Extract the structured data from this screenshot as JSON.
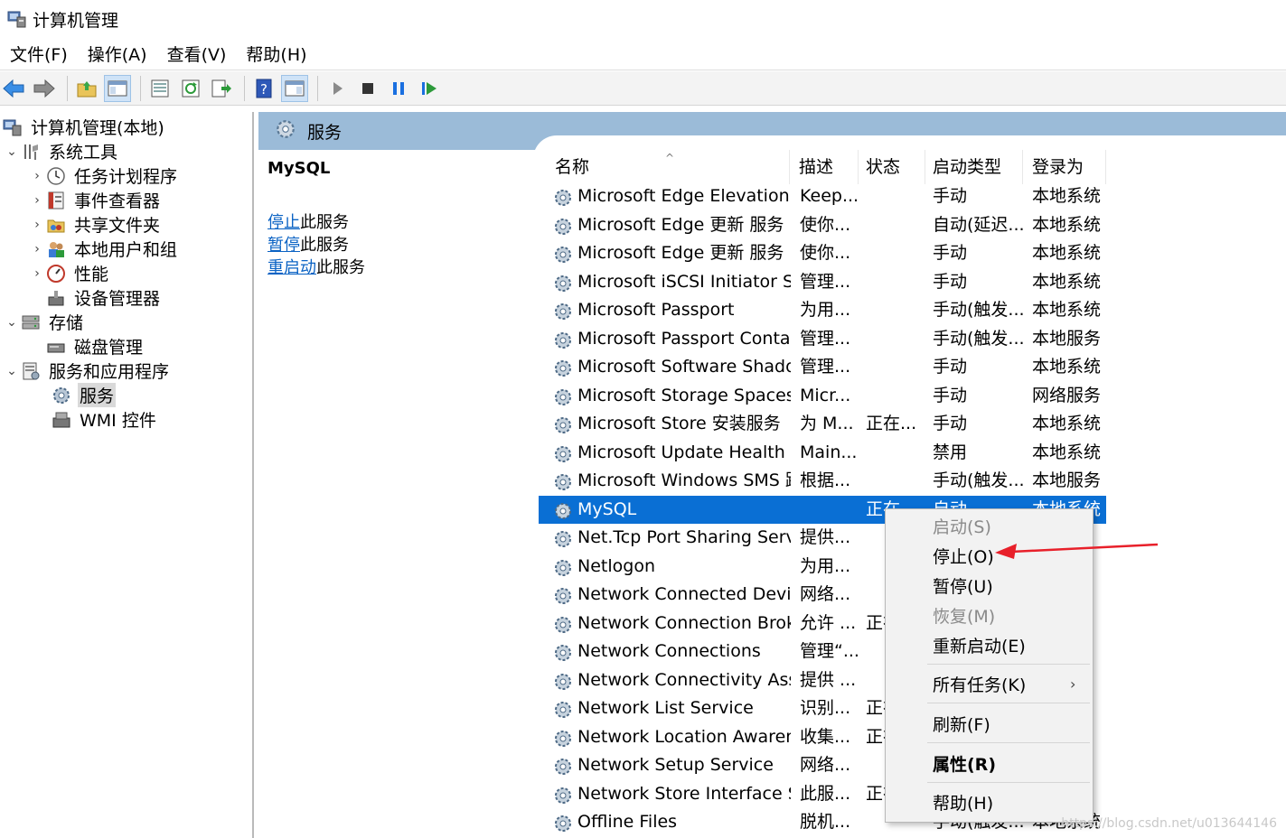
{
  "window": {
    "title": "计算机管理"
  },
  "menu": [
    "文件(F)",
    "操作(A)",
    "查看(V)",
    "帮助(H)"
  ],
  "toolbar": {
    "icons": [
      "back-arrow-icon",
      "forward-arrow-icon",
      "up-folder-icon",
      "show-hide-console-tree-icon",
      "properties-icon",
      "refresh-icon",
      "export-list-icon",
      "help-icon",
      "action-pane-icon",
      "start-service-icon",
      "stop-service-icon",
      "pause-service-icon",
      "resume-service-icon"
    ]
  },
  "tree": {
    "root": "计算机管理(本地)",
    "system_tools": "系统工具",
    "task_scheduler": "任务计划程序",
    "event_viewer": "事件查看器",
    "shared_folders": "共享文件夹",
    "local_users": "本地用户和组",
    "performance": "性能",
    "device_manager": "设备管理器",
    "storage": "存储",
    "disk_management": "磁盘管理",
    "services_apps": "服务和应用程序",
    "services": "服务",
    "wmi": "WMI 控件"
  },
  "band": {
    "title": "服务"
  },
  "detail": {
    "service_name": "MySQL",
    "stop_link": "停止",
    "stop_suffix": "此服务",
    "pause_link": "暂停",
    "pause_suffix": "此服务",
    "restart_link": "重启动",
    "restart_suffix": "此服务"
  },
  "columns": {
    "name": "名称",
    "desc": "描述",
    "status": "状态",
    "startup": "启动类型",
    "logon": "登录为"
  },
  "rows": [
    {
      "name": "Microsoft Edge Elevation S...",
      "desc": "Keep...",
      "status": "",
      "startup": "手动",
      "logon": "本地系统"
    },
    {
      "name": "Microsoft Edge 更新 服务 (...",
      "desc": "使你...",
      "status": "",
      "startup": "自动(延迟...",
      "logon": "本地系统"
    },
    {
      "name": "Microsoft Edge 更新 服务 (...",
      "desc": "使你...",
      "status": "",
      "startup": "手动",
      "logon": "本地系统"
    },
    {
      "name": "Microsoft iSCSI Initiator Ser...",
      "desc": "管理...",
      "status": "",
      "startup": "手动",
      "logon": "本地系统"
    },
    {
      "name": "Microsoft Passport",
      "desc": "为用...",
      "status": "",
      "startup": "手动(触发...",
      "logon": "本地系统"
    },
    {
      "name": "Microsoft Passport Container",
      "desc": "管理...",
      "status": "",
      "startup": "手动(触发...",
      "logon": "本地服务"
    },
    {
      "name": "Microsoft Software Shado...",
      "desc": "管理...",
      "status": "",
      "startup": "手动",
      "logon": "本地系统"
    },
    {
      "name": "Microsoft Storage Spaces S...",
      "desc": "Micr...",
      "status": "",
      "startup": "手动",
      "logon": "网络服务"
    },
    {
      "name": "Microsoft Store 安装服务",
      "desc": "为 M...",
      "status": "正在...",
      "startup": "手动",
      "logon": "本地系统"
    },
    {
      "name": "Microsoft Update Health S...",
      "desc": "Main...",
      "status": "",
      "startup": "禁用",
      "logon": "本地系统"
    },
    {
      "name": "Microsoft Windows SMS 路...",
      "desc": "根据...",
      "status": "",
      "startup": "手动(触发...",
      "logon": "本地服务"
    },
    {
      "name": "MySQL",
      "desc": "",
      "status": "正在...",
      "startup": "自动",
      "logon": "本地系统"
    },
    {
      "name": "Net.Tcp Port Sharing Service",
      "desc": "提供...",
      "status": "",
      "startup": "",
      "logon": ""
    },
    {
      "name": "Netlogon",
      "desc": "为用...",
      "status": "",
      "startup": "",
      "logon": ""
    },
    {
      "name": "Network Connected Devic...",
      "desc": "网络...",
      "status": "",
      "startup": "",
      "logon": ""
    },
    {
      "name": "Network Connection Broker",
      "desc": "允许 ...",
      "status": "正在...",
      "startup": "",
      "logon": ""
    },
    {
      "name": "Network Connections",
      "desc": "管理“...",
      "status": "",
      "startup": "",
      "logon": ""
    },
    {
      "name": "Network Connectivity Assis...",
      "desc": "提供 ...",
      "status": "",
      "startup": "",
      "logon": ""
    },
    {
      "name": "Network List Service",
      "desc": "识别...",
      "status": "正在...",
      "startup": "",
      "logon": ""
    },
    {
      "name": "Network Location Awarene...",
      "desc": "收集...",
      "status": "正在...",
      "startup": "",
      "logon": ""
    },
    {
      "name": "Network Setup Service",
      "desc": "网络...",
      "status": "",
      "startup": "",
      "logon": ""
    },
    {
      "name": "Network Store Interface Se...",
      "desc": "此服...",
      "status": "正在...",
      "startup": "",
      "logon": ""
    },
    {
      "name": "Offline Files",
      "desc": "脱机...",
      "status": "",
      "startup": "手动(触发...",
      "logon": "本地系统"
    }
  ],
  "context_menu": {
    "start": "启动(S)",
    "stop": "停止(O)",
    "pause": "暂停(U)",
    "resume": "恢复(M)",
    "restart": "重新启动(E)",
    "all_tasks": "所有任务(K)",
    "refresh": "刷新(F)",
    "properties": "属性(R)",
    "help": "帮助(H)"
  },
  "annotation": {
    "arrow_color": "#e8202a"
  },
  "watermark": "https://blog.csdn.net/u013644146",
  "colors": {
    "selection": "#0a6fd4",
    "band": "#9bbbd8",
    "link": "#0b63c4"
  }
}
